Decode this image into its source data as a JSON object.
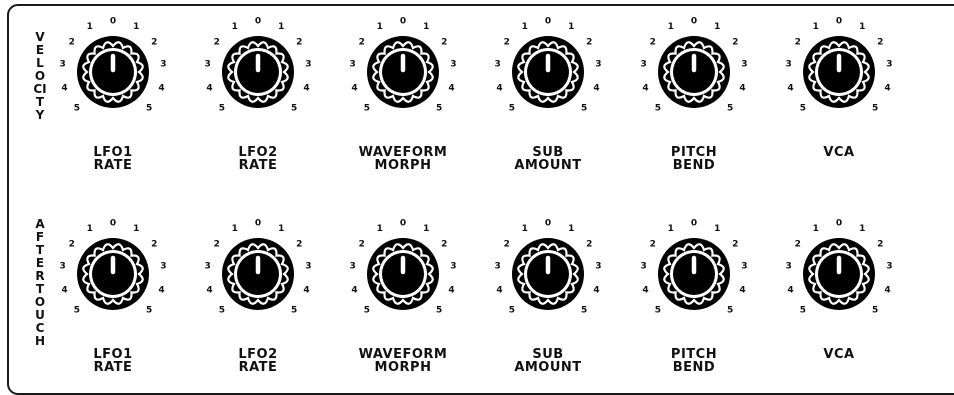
{
  "rows": [
    {
      "label": "VELOCITY",
      "knobs": [
        {
          "line1": "LFO1",
          "line2": "RATE"
        },
        {
          "line1": "LFO2",
          "line2": "RATE"
        },
        {
          "line1": "WAVEFORM",
          "line2": "MORPH"
        },
        {
          "line1": "SUB",
          "line2": "AMOUNT"
        },
        {
          "line1": "PITCH",
          "line2": "BEND"
        },
        {
          "line1": "VCA",
          "line2": ""
        }
      ]
    },
    {
      "label": "AFTERTOUCH",
      "knobs": [
        {
          "line1": "LFO1",
          "line2": "RATE"
        },
        {
          "line1": "LFO2",
          "line2": "RATE"
        },
        {
          "line1": "WAVEFORM",
          "line2": "MORPH"
        },
        {
          "line1": "SUB",
          "line2": "AMOUNT"
        },
        {
          "line1": "PITCH",
          "line2": "BEND"
        },
        {
          "line1": "VCA",
          "line2": ""
        }
      ]
    }
  ],
  "scale_ticks": [
    "5",
    "4",
    "3",
    "2",
    "1",
    "0",
    "1",
    "2",
    "3",
    "4",
    "5"
  ],
  "knob_value": 0,
  "colors": {
    "ink": "#111111",
    "knob": "#000000",
    "background": "#ffffff"
  }
}
